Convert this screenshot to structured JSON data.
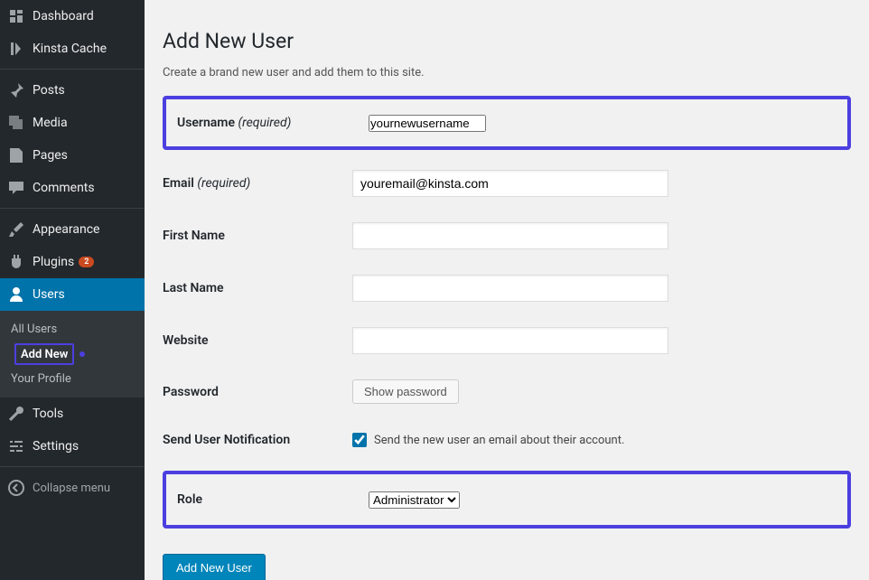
{
  "sidebar": {
    "items": [
      {
        "label": "Dashboard",
        "icon": "dashboard"
      },
      {
        "label": "Kinsta Cache",
        "icon": "kinsta"
      },
      {
        "label": "Posts",
        "icon": "pin"
      },
      {
        "label": "Media",
        "icon": "media"
      },
      {
        "label": "Pages",
        "icon": "pages"
      },
      {
        "label": "Comments",
        "icon": "comment"
      },
      {
        "label": "Appearance",
        "icon": "brush"
      },
      {
        "label": "Plugins",
        "icon": "plug",
        "badge": "2"
      },
      {
        "label": "Users",
        "icon": "user",
        "active": true
      },
      {
        "label": "Tools",
        "icon": "wrench"
      },
      {
        "label": "Settings",
        "icon": "sliders"
      }
    ],
    "submenu": {
      "all_users": "All Users",
      "add_new": "Add New",
      "your_profile": "Your Profile"
    },
    "collapse": "Collapse menu"
  },
  "page": {
    "title": "Add New User",
    "desc": "Create a brand new user and add them to this site.",
    "labels": {
      "username": "Username",
      "email": "Email",
      "required": "(required)",
      "first_name": "First Name",
      "last_name": "Last Name",
      "website": "Website",
      "password": "Password",
      "show_password": "Show password",
      "send_notif": "Send User Notification",
      "notif_text": "Send the new user an email about their account.",
      "role": "Role"
    },
    "values": {
      "username": "yournewusername",
      "email": "youremail@kinsta.com",
      "first_name": "",
      "last_name": "",
      "website": "",
      "role_selected": "Administrator",
      "notif_checked": true
    },
    "submit": "Add New User"
  }
}
